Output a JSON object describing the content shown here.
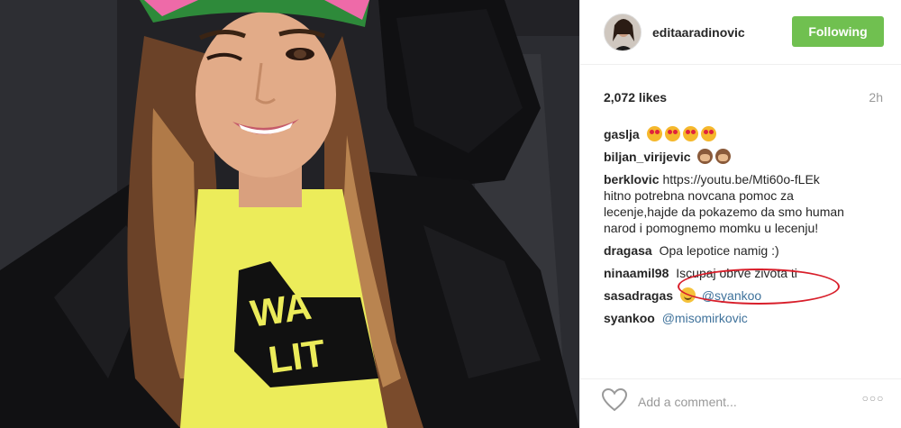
{
  "post": {
    "photo_description_icon": "selfie-photo",
    "header": {
      "username": "editaaradinovic",
      "follow_button": "Following"
    },
    "likes": "2,072 likes",
    "time": "2h",
    "comments": [
      {
        "user": "gaslja",
        "text": "",
        "emojis": [
          "heart-eyes",
          "heart-eyes",
          "heart-eyes",
          "heart-eyes"
        ]
      },
      {
        "user": "biljan_virijevic",
        "text": "",
        "emojis": [
          "monkey",
          "monkey"
        ]
      },
      {
        "user": "berklovic",
        "text_lines": [
          "https://youtu.be/Mti60o-fLEk",
          "hitno potrebna novcana pomoc za",
          "lecenje,hajde da pokazemo da smo human",
          "narod i pomognemo momku u lecenju!"
        ]
      },
      {
        "user": "dragasa",
        "text": "Opa lepotice namig :)"
      },
      {
        "user": "ninaamil98",
        "text": "Iscupaj obrve zivota ti"
      },
      {
        "user": "sasadragas",
        "mention": "@syankoo",
        "emojis": [
          "smile"
        ]
      },
      {
        "user": "syankoo",
        "mention": "@misomirkovic"
      }
    ],
    "footer": {
      "add_comment_placeholder": "Add a comment...",
      "more_label": "○○○"
    },
    "colors": {
      "follow_green": "#70c050",
      "highlight_red": "#d81e2a",
      "mention_blue": "#3f729b"
    }
  }
}
